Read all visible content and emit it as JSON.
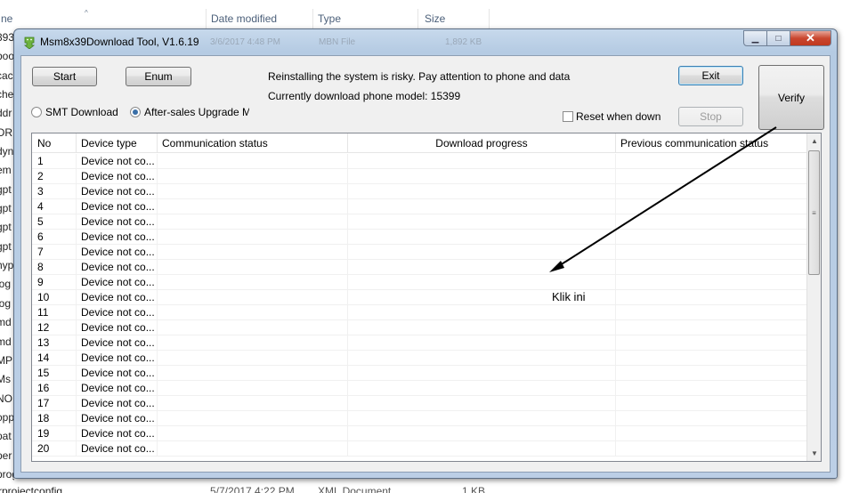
{
  "explorer": {
    "columns": [
      "ne",
      "Date modified",
      "Type",
      "Size"
    ],
    "left_fragments": [
      "393",
      "boo",
      "cac",
      "che",
      "ddr",
      "ORI",
      "dyn",
      "em",
      "gpt",
      "gpt",
      "gpt",
      "gpt",
      "hyp",
      "log",
      "log",
      "md",
      "md",
      "MP",
      "Ms",
      "NO",
      "opp",
      "pat",
      "per",
      "prog"
    ],
    "bottom": {
      "name": "rprojectconfig",
      "date": "5/7/2017 4:22 PM",
      "type": "XML Document",
      "size": "1 KB"
    }
  },
  "window": {
    "title": "Msm8x39Download Tool, V1.6.19",
    "ghost": [
      "3/6/2017 4:48 PM",
      "MBN File",
      "1,892 KB"
    ],
    "controls": {
      "minimize": "▁",
      "maximize": "□",
      "close": "✕"
    }
  },
  "toolbar": {
    "start": "Start",
    "enum": "Enum",
    "exit": "Exit",
    "verify": "Verify",
    "stop": "Stop",
    "warning": "Reinstalling the system is risky. Pay attention to phone and data",
    "model": "Currently download phone model: 15399",
    "smt_mode": "SMT Download Mc",
    "aftersales_mode": "After-sales Upgrade Moc",
    "reset_label": "Reset when downlc"
  },
  "grid": {
    "headers": [
      "No",
      "Device type",
      "Communication status",
      "Download progress",
      "Previous communication status"
    ],
    "rows": [
      {
        "no": "1",
        "device": "Device not co..."
      },
      {
        "no": "2",
        "device": "Device not co..."
      },
      {
        "no": "3",
        "device": "Device not co..."
      },
      {
        "no": "4",
        "device": "Device not co..."
      },
      {
        "no": "5",
        "device": "Device not co..."
      },
      {
        "no": "6",
        "device": "Device not co..."
      },
      {
        "no": "7",
        "device": "Device not co..."
      },
      {
        "no": "8",
        "device": "Device not co..."
      },
      {
        "no": "9",
        "device": "Device not co..."
      },
      {
        "no": "10",
        "device": "Device not co..."
      },
      {
        "no": "11",
        "device": "Device not co..."
      },
      {
        "no": "12",
        "device": "Device not co..."
      },
      {
        "no": "13",
        "device": "Device not co..."
      },
      {
        "no": "14",
        "device": "Device not co..."
      },
      {
        "no": "15",
        "device": "Device not co..."
      },
      {
        "no": "16",
        "device": "Device not co..."
      },
      {
        "no": "17",
        "device": "Device not co..."
      },
      {
        "no": "18",
        "device": "Device not co..."
      },
      {
        "no": "19",
        "device": "Device not co..."
      },
      {
        "no": "20",
        "device": "Device not co..."
      }
    ]
  },
  "annotation": {
    "text": "Klik ini"
  }
}
